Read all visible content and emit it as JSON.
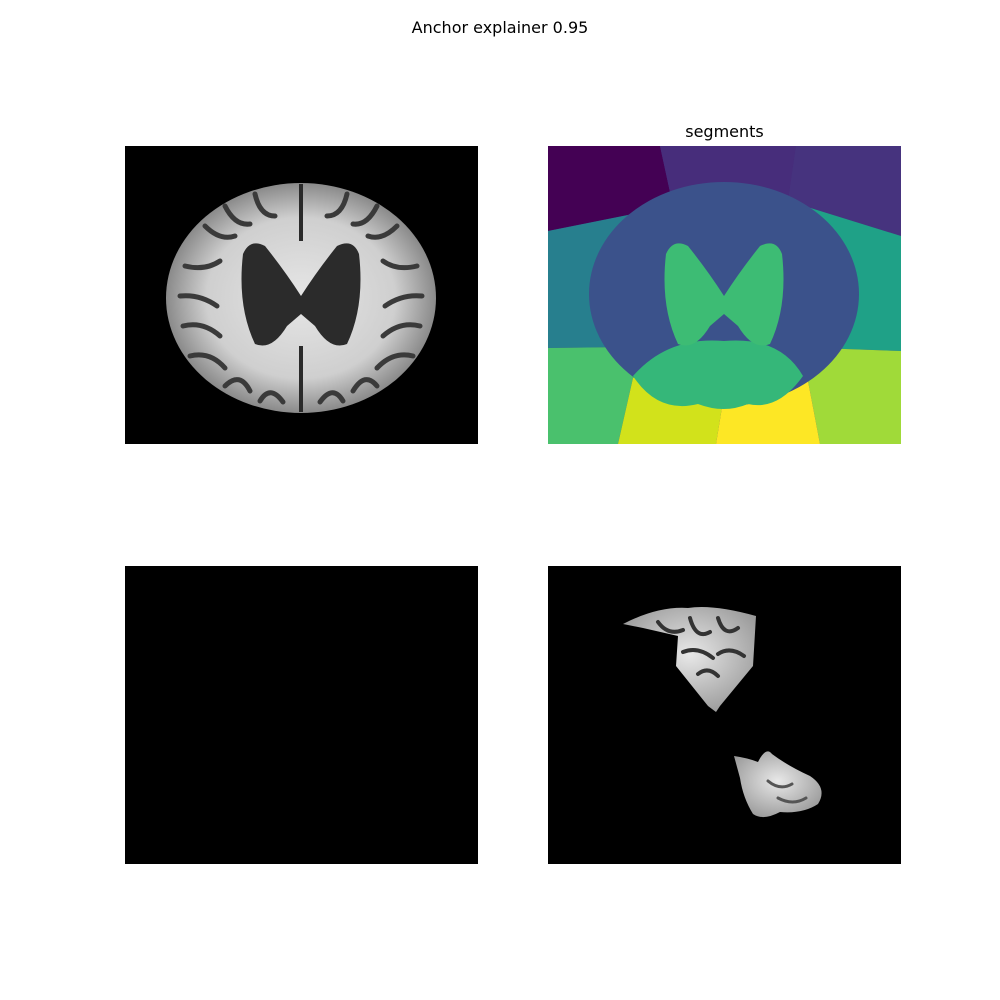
{
  "figure": {
    "suptitle": "Anchor explainer 0.95"
  },
  "panels": {
    "original": {
      "title": ""
    },
    "segments": {
      "title": "segments"
    },
    "empty": {
      "title": ""
    },
    "anchor": {
      "title": ""
    }
  },
  "colors": {
    "background": "#ffffff",
    "image_background": "#000000",
    "segment_palette": [
      "#440154",
      "#46337e",
      "#365c8d",
      "#277f8e",
      "#1fa187",
      "#4ac16d",
      "#a0da39",
      "#d2e21b",
      "#fde725"
    ]
  }
}
